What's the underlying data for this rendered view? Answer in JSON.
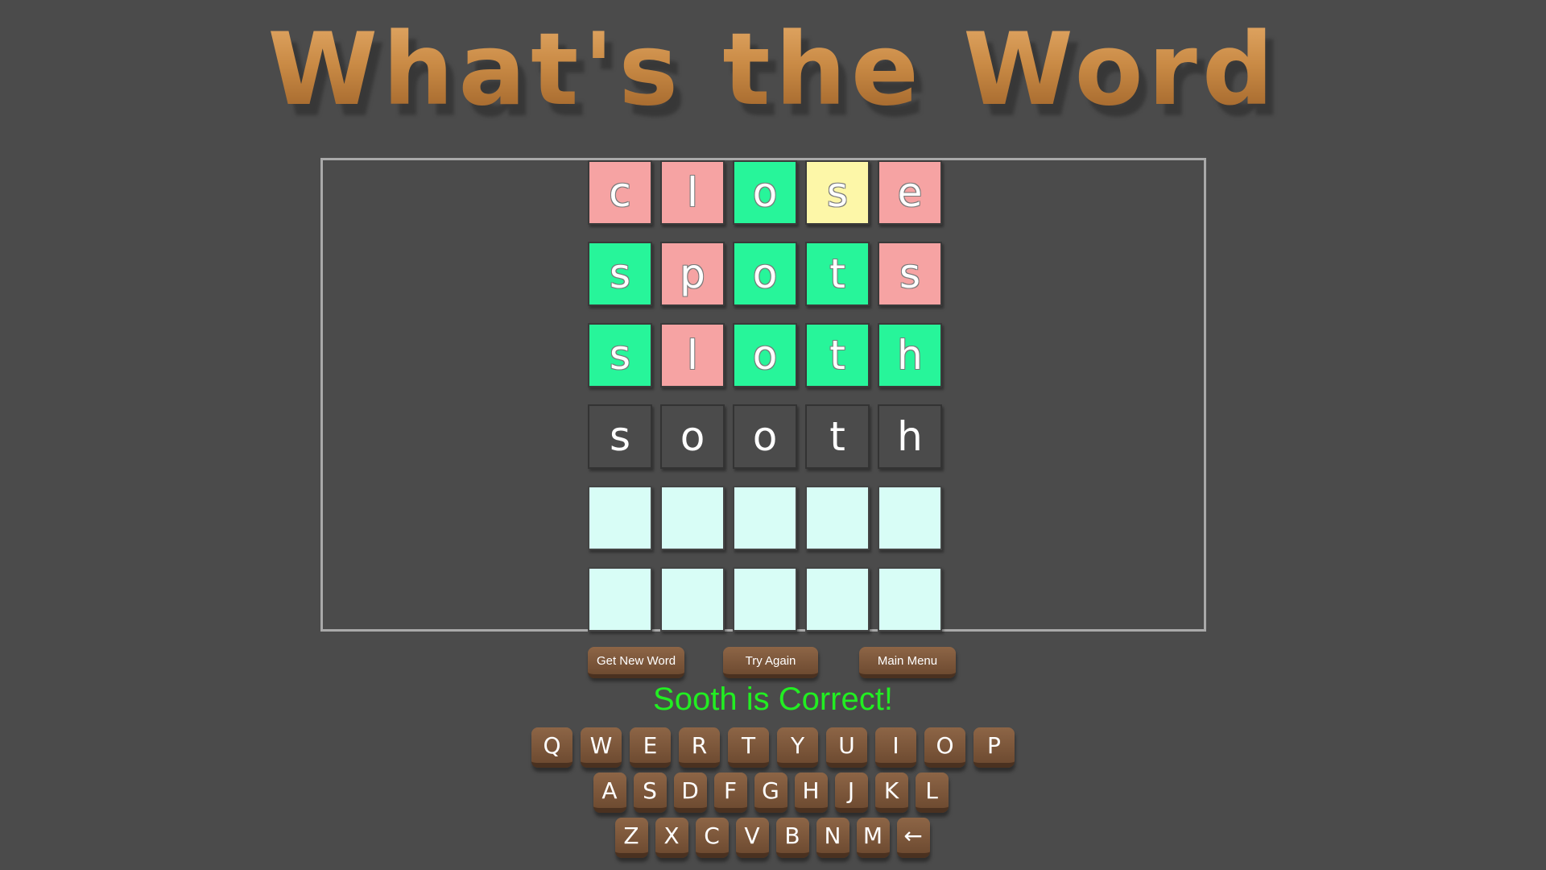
{
  "title": "What's the Word",
  "board": [
    [
      {
        "letter": "c",
        "state": "absent"
      },
      {
        "letter": "l",
        "state": "absent"
      },
      {
        "letter": "o",
        "state": "correct"
      },
      {
        "letter": "s",
        "state": "present"
      },
      {
        "letter": "e",
        "state": "absent"
      }
    ],
    [
      {
        "letter": "s",
        "state": "correct"
      },
      {
        "letter": "p",
        "state": "absent"
      },
      {
        "letter": "o",
        "state": "correct"
      },
      {
        "letter": "t",
        "state": "correct"
      },
      {
        "letter": "s",
        "state": "absent"
      }
    ],
    [
      {
        "letter": "s",
        "state": "correct"
      },
      {
        "letter": "l",
        "state": "absent"
      },
      {
        "letter": "o",
        "state": "correct"
      },
      {
        "letter": "t",
        "state": "correct"
      },
      {
        "letter": "h",
        "state": "correct"
      }
    ],
    [
      {
        "letter": "s",
        "state": "typed"
      },
      {
        "letter": "o",
        "state": "typed"
      },
      {
        "letter": "o",
        "state": "typed"
      },
      {
        "letter": "t",
        "state": "typed"
      },
      {
        "letter": "h",
        "state": "typed"
      }
    ],
    [
      {
        "letter": "",
        "state": "empty"
      },
      {
        "letter": "",
        "state": "empty"
      },
      {
        "letter": "",
        "state": "empty"
      },
      {
        "letter": "",
        "state": "empty"
      },
      {
        "letter": "",
        "state": "empty"
      }
    ],
    [
      {
        "letter": "",
        "state": "empty"
      },
      {
        "letter": "",
        "state": "empty"
      },
      {
        "letter": "",
        "state": "empty"
      },
      {
        "letter": "",
        "state": "empty"
      },
      {
        "letter": "",
        "state": "empty"
      }
    ]
  ],
  "actions": {
    "new_word": "Get New Word",
    "try_again": "Try Again",
    "main_menu": "Main Menu"
  },
  "status": "Sooth is Correct!",
  "keyboard": {
    "row1": [
      "Q",
      "W",
      "E",
      "R",
      "T",
      "Y",
      "U",
      "I",
      "O",
      "P"
    ],
    "row2": [
      "A",
      "S",
      "D",
      "F",
      "G",
      "H",
      "J",
      "K",
      "L"
    ],
    "row3": [
      "Z",
      "X",
      "C",
      "V",
      "B",
      "N",
      "M",
      "←"
    ]
  },
  "colors": {
    "background": "#4b4b4b",
    "absent": "#f6a3a3",
    "correct": "#27f59a",
    "present": "#fdf7a8",
    "empty": "#d8fdf6",
    "status_text": "#22ee22",
    "key_wood": "#7a5539"
  }
}
